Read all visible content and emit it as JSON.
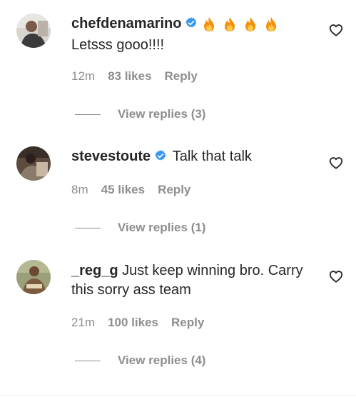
{
  "comments": [
    {
      "username": "chefdenamarino",
      "verified": true,
      "emoji": "🔥🔥🔥🔥",
      "text_line1": "",
      "text_line2": "Letsss gooo!!!!",
      "time": "12m",
      "likes": "83 likes",
      "reply": "Reply",
      "view_replies": "View replies (3)"
    },
    {
      "username": "stevestoute",
      "verified": true,
      "text_line1": "Talk that talk",
      "time": "8m",
      "likes": "45 likes",
      "reply": "Reply",
      "view_replies": "View replies (1)"
    },
    {
      "username": "_reg_g",
      "verified": false,
      "text_line1": "Just keep winning bro. Carry",
      "text_line2": "this sorry ass team",
      "time": "21m",
      "likes": "100 likes",
      "reply": "Reply",
      "view_replies": "View replies (4)"
    }
  ],
  "colors": {
    "primary_text": "#262626",
    "secondary_text": "#8e8e8e",
    "verified_badge": "#3897f0"
  },
  "icons": {
    "like": "heart-outline-icon",
    "verified": "verified-badge-icon",
    "emoji": "fire-emoji-icon"
  }
}
